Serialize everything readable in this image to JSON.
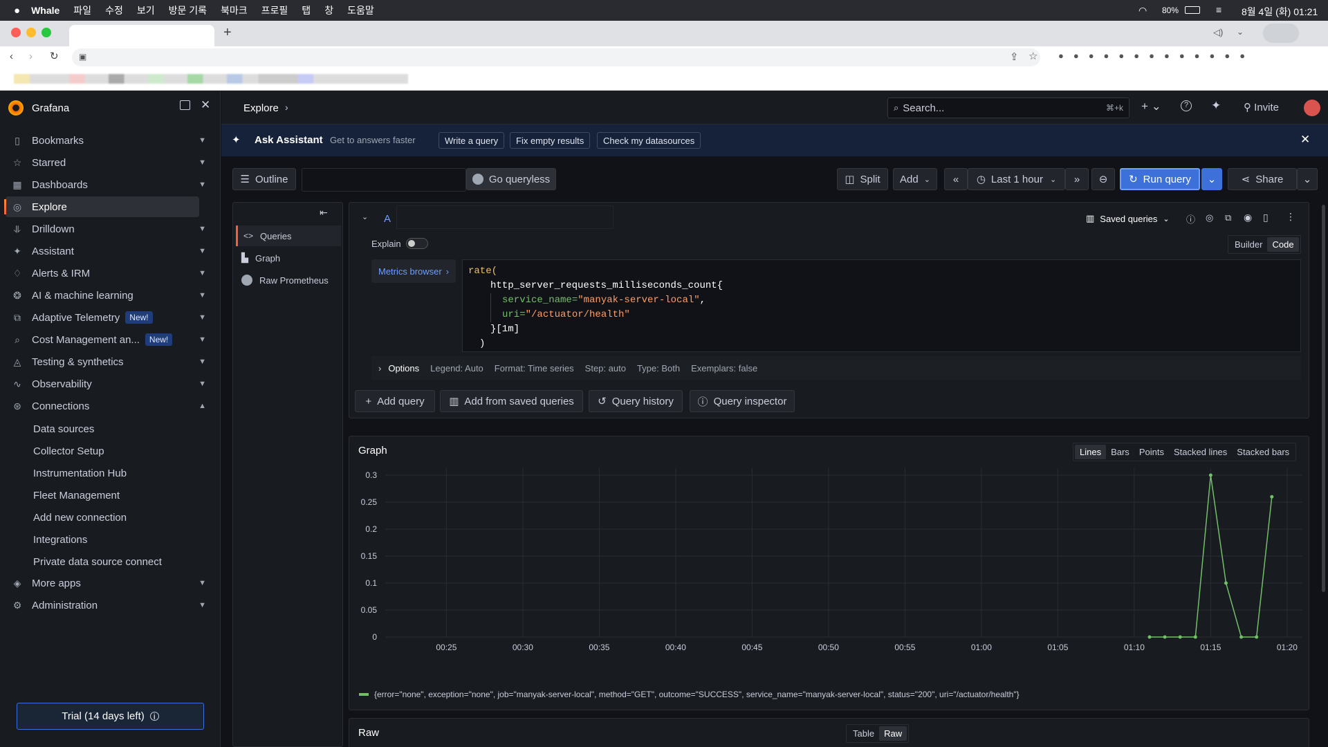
{
  "menubar": {
    "app": "Whale",
    "items": [
      "파일",
      "수정",
      "보기",
      "방문 기록",
      "북마크",
      "프로필",
      "탭",
      "창",
      "도움말"
    ],
    "battery": "80%",
    "datetime": "8월 4일 (화) 01:21"
  },
  "grafana": {
    "brand": "Grafana",
    "breadcrumb": "Explore",
    "search_placeholder": "Search...",
    "search_shortcut": "⌘+k",
    "invite": "Invite",
    "nav": [
      {
        "label": "Bookmarks",
        "icon": "bookmark-icon"
      },
      {
        "label": "Starred",
        "icon": "star-icon"
      },
      {
        "label": "Dashboards",
        "icon": "dashboard-icon"
      },
      {
        "label": "Explore",
        "icon": "compass-icon"
      },
      {
        "label": "Drilldown",
        "icon": "drilldown-icon"
      },
      {
        "label": "Assistant",
        "icon": "sparkle-icon"
      },
      {
        "label": "Alerts & IRM",
        "icon": "bell-icon"
      },
      {
        "label": "AI & machine learning",
        "icon": "brain-icon"
      },
      {
        "label": "Adaptive Telemetry",
        "icon": "telemetry-icon",
        "badge": "New!"
      },
      {
        "label": "Cost Management an...",
        "icon": "cost-icon",
        "badge": "New!"
      },
      {
        "label": "Testing & synthetics",
        "icon": "testing-icon"
      },
      {
        "label": "Observability",
        "icon": "pulse-icon"
      },
      {
        "label": "Connections",
        "icon": "connections-icon"
      }
    ],
    "sub": [
      "Data sources",
      "Collector Setup",
      "Instrumentation Hub",
      "Fleet Management",
      "Add new connection",
      "Integrations",
      "Private data source connect"
    ],
    "nav_bottom": [
      {
        "label": "More apps",
        "icon": "layers-icon"
      },
      {
        "label": "Administration",
        "icon": "gear-icon"
      }
    ],
    "trial": "Trial (14 days left)",
    "assistant": {
      "title": "Ask Assistant",
      "subtitle": "Get to answers faster",
      "actions": [
        "Write a query",
        "Fix empty results",
        "Check my datasources"
      ]
    },
    "toolbar": {
      "outline": "Outline",
      "queryless": "Go queryless",
      "split": "Split",
      "add": "Add",
      "time": "Last 1 hour",
      "run": "Run query",
      "share": "Share"
    },
    "outline": [
      "Queries",
      "Graph",
      "Raw Prometheus"
    ],
    "query": {
      "letter": "A",
      "saved": "Saved queries",
      "explain": "Explain",
      "builder": "Builder",
      "code": "Code",
      "metrics_browser": "Metrics browser",
      "lines": [
        "rate(",
        "http_server_requests_milliseconds_count{",
        "service_name=",
        "\"manyak-server-local\"",
        ",",
        "uri=",
        "\"/actuator/health\"",
        "}[1m]",
        ")"
      ],
      "options": {
        "label": "Options",
        "legend": "Legend: Auto",
        "format": "Format: Time series",
        "step": "Step: auto",
        "type": "Type: Both",
        "exemplars": "Exemplars: false"
      }
    },
    "query_actions": [
      "Add query",
      "Add from saved queries",
      "Query history",
      "Query inspector"
    ],
    "graph": {
      "title": "Graph",
      "modes": [
        "Lines",
        "Bars",
        "Points",
        "Stacked lines",
        "Stacked bars"
      ]
    },
    "raw": {
      "title": "Raw",
      "modes": [
        "Table",
        "Raw"
      ]
    }
  },
  "chart_data": {
    "type": "line",
    "x": [
      "01:11",
      "01:12",
      "01:13",
      "01:14",
      "01:15",
      "01:16",
      "01:17",
      "01:18",
      "01:19",
      "01:20"
    ],
    "series": [
      {
        "name": "{error=\"none\", exception=\"none\", job=\"manyak-server-local\", method=\"GET\", outcome=\"SUCCESS\", service_name=\"manyak-server-local\", status=\"200\", uri=\"/actuator/health\"}",
        "values": [
          0,
          0,
          0,
          0,
          0.3,
          0.1,
          0,
          0,
          0.26,
          null
        ],
        "color": "#73bf69"
      }
    ],
    "xticks": [
      "00:25",
      "00:30",
      "00:35",
      "00:40",
      "00:45",
      "00:50",
      "00:55",
      "01:00",
      "01:05",
      "01:10",
      "01:15",
      "01:20"
    ],
    "yticks": [
      "0",
      "0.05",
      "0.1",
      "0.15",
      "0.2",
      "0.25",
      "0.3"
    ],
    "ylim": [
      0,
      0.3
    ]
  }
}
